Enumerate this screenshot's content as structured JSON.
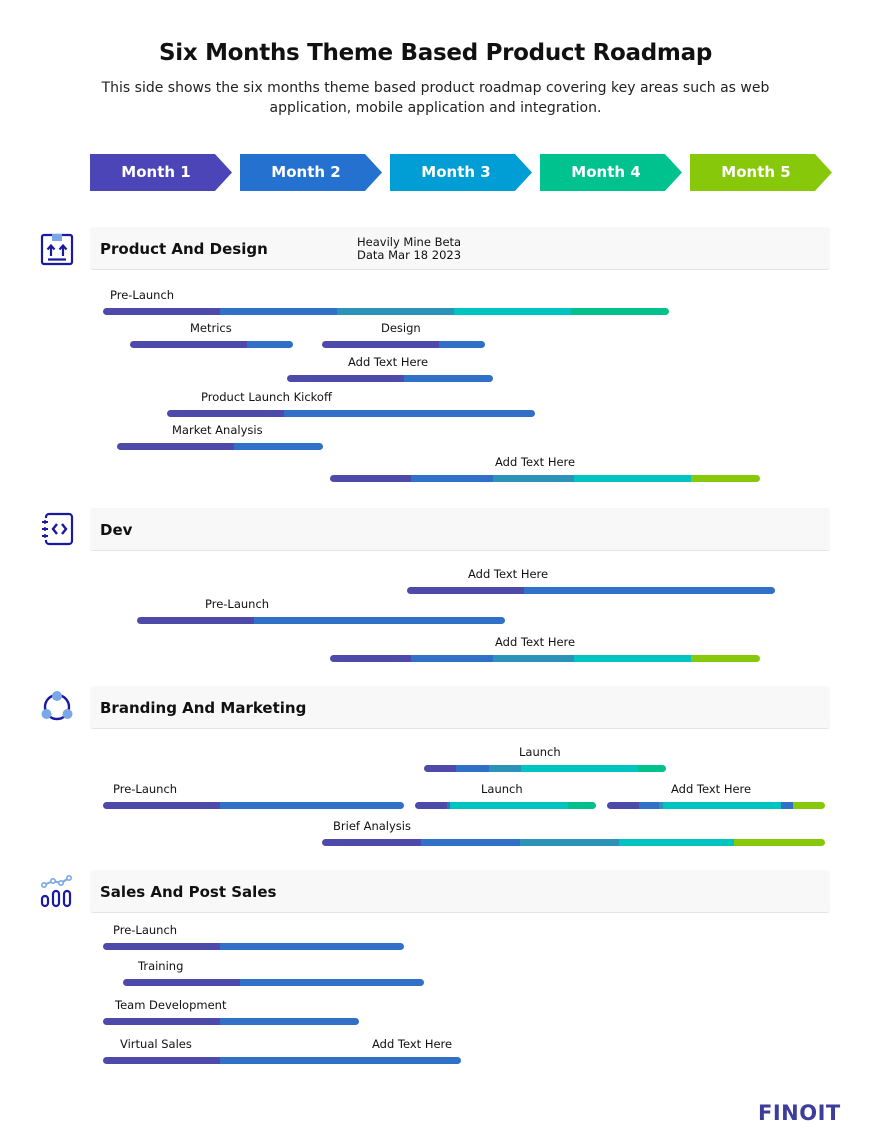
{
  "header": {
    "title": "Six Months Theme Based Product Roadmap",
    "subtitle": "This side shows the six months theme based product roadmap covering key areas such as web application, mobile application and integration."
  },
  "colors": {
    "purple": "#4e4aaa",
    "blue": "#3070c6",
    "teal": "#2b93b8",
    "cyan": "#00c4c0",
    "green": "#00c08c",
    "lime": "#88c80a",
    "icon_dark": "#1a1aa0",
    "icon_light": "#7aa7e6"
  },
  "months": [
    {
      "label": "Month 1",
      "color": "#4b45b8"
    },
    {
      "label": "Month 2",
      "color": "#2471cf"
    },
    {
      "label": "Month 3",
      "color": "#009ed4"
    },
    {
      "label": "Month 4",
      "color": "#00c28f"
    },
    {
      "label": "Month 5",
      "color": "#88c80a"
    }
  ],
  "sections": [
    {
      "title": "Product And Design",
      "icon": "package-arrows-up-icon",
      "note_line1": "Heavily Mine Beta",
      "note_line2": "Data Mar 18 2023",
      "tasks": [
        {
          "label": "Pre-Launch"
        },
        {
          "label": "Metrics"
        },
        {
          "label": "Design"
        },
        {
          "label": "Add Text Here"
        },
        {
          "label": "Product Launch Kickoff"
        },
        {
          "label": "Market Analysis"
        },
        {
          "label": "Add Text Here"
        }
      ]
    },
    {
      "title": "Dev",
      "icon": "code-notebook-icon",
      "tasks": [
        {
          "label": "Add Text Here"
        },
        {
          "label": "Pre-Launch"
        },
        {
          "label": "Add Text Here"
        }
      ]
    },
    {
      "title": "Branding And Marketing",
      "icon": "share-network-icon",
      "tasks": [
        {
          "label": "Launch"
        },
        {
          "label": "Pre-Launch"
        },
        {
          "label": "Launch"
        },
        {
          "label": "Add Text Here"
        },
        {
          "label": "Brief Analysis"
        }
      ]
    },
    {
      "title": "Sales And Post Sales",
      "icon": "analytics-chart-icon",
      "tasks": [
        {
          "label": "Pre-Launch"
        },
        {
          "label": "Training"
        },
        {
          "label": "Team Development"
        },
        {
          "label": "Virtual Sales"
        },
        {
          "label": "Add Text Here"
        }
      ]
    }
  ],
  "logo": {
    "text": "FINOIT"
  }
}
